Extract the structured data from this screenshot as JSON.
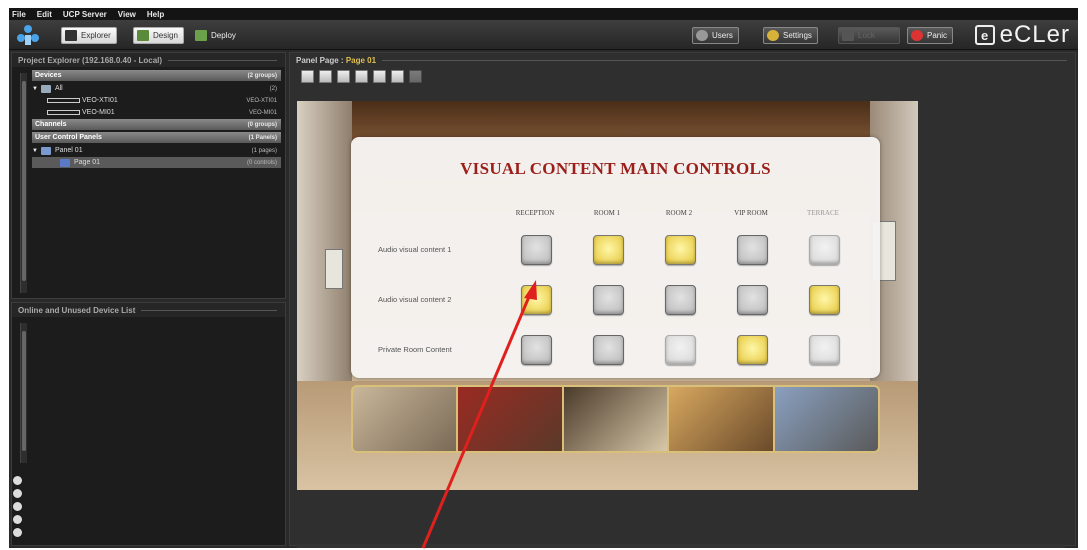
{
  "menu": [
    "File",
    "Edit",
    "UCP Server",
    "View",
    "Help"
  ],
  "toolbar": {
    "explorer": "Explorer",
    "designer": "Design",
    "deploy": "Deploy",
    "users": "Users",
    "settings": "Settings",
    "lock": "Lock",
    "panic": "Panic"
  },
  "brand": {
    "mark": "e",
    "word": "eCLer"
  },
  "explorer": {
    "title": "Project Explorer (192.168.0.40 - Local)",
    "devices": {
      "label": "Devices",
      "count": "(2 groups)"
    },
    "all": {
      "label": "All",
      "count": "(2)"
    },
    "dev1": {
      "label": "VEO-XTI01",
      "id": "VEO-XTI01"
    },
    "dev2": {
      "label": "VEO-MI01",
      "id": "VEO-MI01"
    },
    "channels": {
      "label": "Channels",
      "count": "(0 groups)"
    },
    "ucp": {
      "label": "User Control Panels",
      "count": "(1 Panels)"
    },
    "panel": {
      "label": "Panel 01",
      "count": "(1 pages)"
    },
    "page": {
      "label": "Page 01",
      "count": "(0 controls)"
    }
  },
  "device_list": {
    "title": "Online and Unused Device List"
  },
  "panel_page": {
    "label": "Panel Page :",
    "value": "Page 01"
  },
  "ucp_page": {
    "title": "VISUAL CONTENT MAIN CONTROLS",
    "columns": [
      "RECEPTION",
      "ROOM 1",
      "ROOM 2",
      "VIP ROOM",
      "TERRACE"
    ],
    "rows": [
      {
        "label": "Audio visual content 1",
        "states": [
          "off",
          "on",
          "on",
          "off",
          "faint"
        ]
      },
      {
        "label": "Audio visual content 2",
        "states": [
          "on",
          "off",
          "off",
          "off",
          "on"
        ]
      },
      {
        "label": "Private Room Content",
        "states": [
          "off",
          "off",
          "faint",
          "on",
          "faint"
        ]
      }
    ]
  },
  "colors": {
    "title_red": "#9a1f1a",
    "active_pad": "#e5c63a",
    "annotation_arrow": "#e0201c"
  }
}
